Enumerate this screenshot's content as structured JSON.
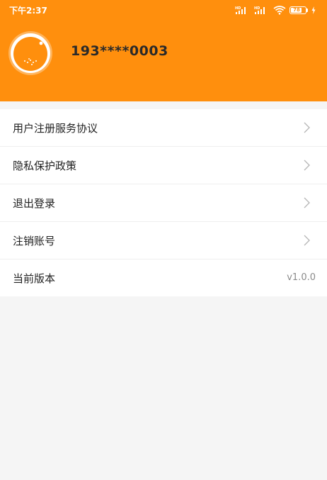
{
  "status_bar": {
    "time": "下午2:37",
    "signal_labels": [
      "HD",
      "HD"
    ],
    "battery_percent": "78"
  },
  "profile": {
    "phone": "193****0003",
    "avatar_icon": "orange-fruit-icon"
  },
  "menu": {
    "items": [
      {
        "label": "用户注册服务协议",
        "icon": "chevron-right-icon"
      },
      {
        "label": "隐私保护政策",
        "icon": "chevron-right-icon"
      },
      {
        "label": "退出登录",
        "icon": "chevron-right-icon"
      },
      {
        "label": "注销账号",
        "icon": "chevron-right-icon"
      },
      {
        "label": "当前版本",
        "value": "v1.0.0"
      }
    ]
  },
  "colors": {
    "accent": "#ff8f0d",
    "background": "#f5f5f5"
  }
}
